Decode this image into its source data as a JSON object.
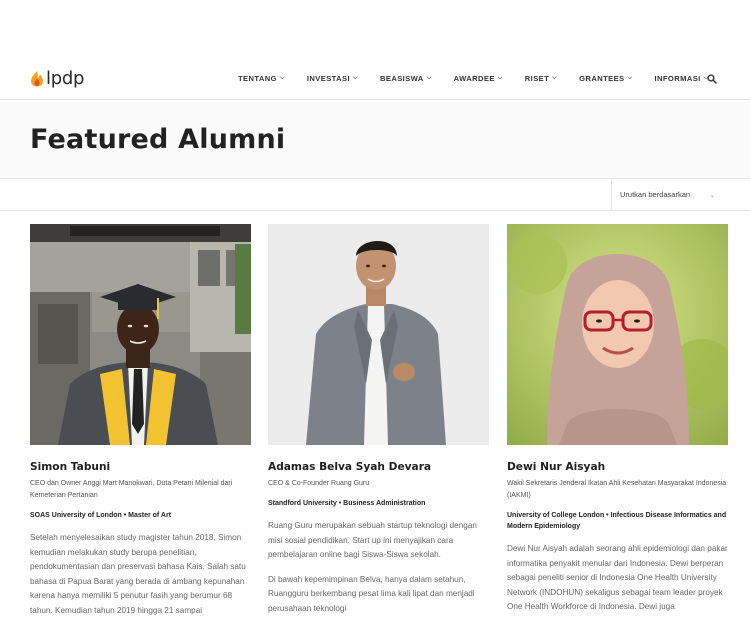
{
  "brand": {
    "logo_text": "lpdp",
    "accent": "#f4a21c",
    "accent2": "#e1522a"
  },
  "nav": {
    "items": [
      {
        "label": "TENTANG"
      },
      {
        "label": "INVESTASI"
      },
      {
        "label": "BEASISWA"
      },
      {
        "label": "AWARDEE"
      },
      {
        "label": "RISET"
      },
      {
        "label": "GRANTEES"
      },
      {
        "label": "INFORMASI"
      }
    ],
    "search_icon": "search-icon"
  },
  "page": {
    "title": "Featured Alumni"
  },
  "sort": {
    "label": "Urutkan berdasarkan"
  },
  "alumni": [
    {
      "name": "Simon Tabuni",
      "role": "CEO dan Owner Anggi Mart Manokwari, Duta Petani Milenial dari Kemeterian Pertanian",
      "university": "SOAS University of London • Master of Art",
      "paragraphs": [
        "Setelah menyelesaikan study magister tahun 2018, Simon kemudian melakukan study berupa penelitian, pendokumentasian dan preservasi bahasa Kais. Salah satu bahasa di Papua Barat yang berada di ambang kepunahan karena hanya memiliki 5 penutur fasih yang berumur 68 tahun. Kemudian tahun 2019 hingga 21 sampai"
      ]
    },
    {
      "name": "Adamas Belva Syah Devara",
      "role": "CEO & Co-Founder Ruang Guru",
      "university": "Standford University • Business Administration",
      "paragraphs": [
        "Ruang Guru merupakan sebuah startup teknologi dengan misi sosial pendidikan. Start up ini menyajikan cara pembelajaran online bagi Siswa-Siswa sekolah.",
        "Di bawah kepemimpinan Belva, hanya dalam setahun, Ruangguru berkembang pesat lima kali lipat dan menjadi perusahaan teknologi"
      ]
    },
    {
      "name": "Dewi Nur Aisyah",
      "role": "Wakil Sekretaris Jenderal Ikatan Ahli Kesehatan Masyarakat Indonesia (IAKMI)",
      "university": "University of College London • Infectious Disease Informatics and Modern Epidemiology",
      "paragraphs": [
        "Dewi Nur Aisyah adalah seorang ahli epidemiologi dan pakar informatika penyakit menular dari Indonesia. Dewi berperan sebagai peneliti senior di Indonesia One Health University Network (INDOHUN) sekaligus sebagai team leader proyek One Health Workforce di Indonesia. Dewi juga"
      ]
    }
  ]
}
